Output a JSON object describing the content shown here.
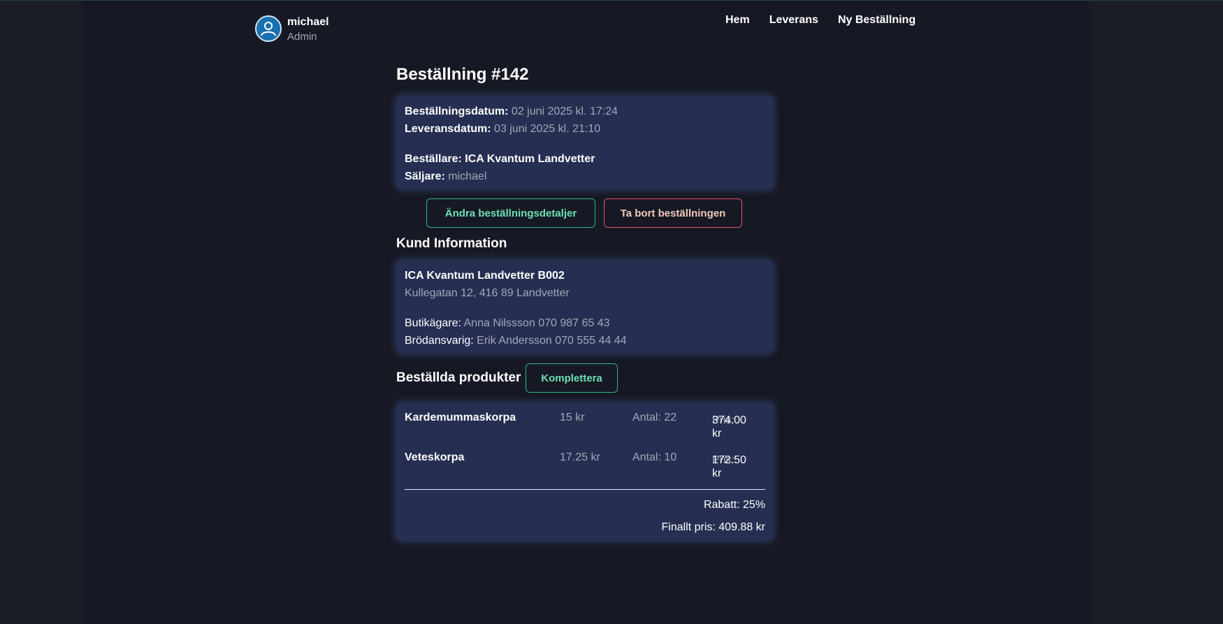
{
  "header": {
    "user_name": "michael",
    "user_role": "Admin",
    "nav": [
      "Hem",
      "Leverans",
      "Ny Beställning"
    ]
  },
  "order": {
    "title": "Beställning #142",
    "order_date_label": "Beställningsdatum:",
    "order_date": "02 juni 2025 kl. 17:24",
    "delivery_date_label": "Leveransdatum:",
    "delivery_date": "03 juni 2025 kl. 21:10",
    "buyer_label": "Beställare:",
    "buyer": "ICA Kvantum Landvetter",
    "seller_label": "Säljare:",
    "seller": "michael"
  },
  "actions": {
    "edit_label": "Ändra beställningsdetaljer",
    "delete_label": "Ta bort beställningen"
  },
  "customer": {
    "section_title": "Kund Information",
    "name": "ICA Kvantum Landvetter B002",
    "address": "Kullegatan 12, 416 89 Landvetter",
    "owner_label": "Butikägare:",
    "owner": "Anna Nilssson 070 987 65 43",
    "bread_label": "Brödansvarig:",
    "bread": "Erik Andersson 070 555 44 44"
  },
  "products": {
    "section_title": "Beställda produkter",
    "complete_label": "Komplettera",
    "price_label": "Pris:",
    "items": [
      {
        "name": "Kardemummaskorpa",
        "unit_price": "15 kr",
        "quantity": "Antal: 22",
        "total": "374.00 kr"
      },
      {
        "name": "Veteskorpa",
        "unit_price": "17.25 kr",
        "quantity": "Antal: 10",
        "total": "172.50 kr"
      }
    ],
    "discount": "Rabatt: 25%",
    "final_price": "Finallt pris: 409.88 kr"
  },
  "colors": {
    "background": "#161924",
    "card": "#262e52",
    "accent_green": "#2db38a",
    "accent_red": "#e25565"
  },
  "icons": {
    "avatar": "user-icon"
  }
}
